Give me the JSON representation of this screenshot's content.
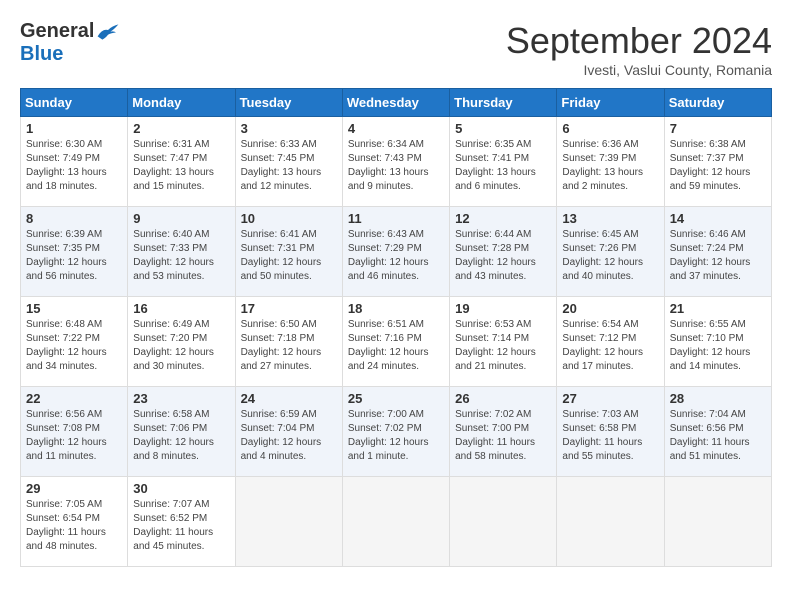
{
  "header": {
    "logo_general": "General",
    "logo_blue": "Blue",
    "title": "September 2024",
    "location": "Ivesti, Vaslui County, Romania"
  },
  "weekdays": [
    "Sunday",
    "Monday",
    "Tuesday",
    "Wednesday",
    "Thursday",
    "Friday",
    "Saturday"
  ],
  "weeks": [
    [
      {
        "day": "1",
        "sunrise": "6:30 AM",
        "sunset": "7:49 PM",
        "daylight": "13 hours and 18 minutes."
      },
      {
        "day": "2",
        "sunrise": "6:31 AM",
        "sunset": "7:47 PM",
        "daylight": "13 hours and 15 minutes."
      },
      {
        "day": "3",
        "sunrise": "6:33 AM",
        "sunset": "7:45 PM",
        "daylight": "13 hours and 12 minutes."
      },
      {
        "day": "4",
        "sunrise": "6:34 AM",
        "sunset": "7:43 PM",
        "daylight": "13 hours and 9 minutes."
      },
      {
        "day": "5",
        "sunrise": "6:35 AM",
        "sunset": "7:41 PM",
        "daylight": "13 hours and 6 minutes."
      },
      {
        "day": "6",
        "sunrise": "6:36 AM",
        "sunset": "7:39 PM",
        "daylight": "13 hours and 2 minutes."
      },
      {
        "day": "7",
        "sunrise": "6:38 AM",
        "sunset": "7:37 PM",
        "daylight": "12 hours and 59 minutes."
      }
    ],
    [
      {
        "day": "8",
        "sunrise": "6:39 AM",
        "sunset": "7:35 PM",
        "daylight": "12 hours and 56 minutes."
      },
      {
        "day": "9",
        "sunrise": "6:40 AM",
        "sunset": "7:33 PM",
        "daylight": "12 hours and 53 minutes."
      },
      {
        "day": "10",
        "sunrise": "6:41 AM",
        "sunset": "7:31 PM",
        "daylight": "12 hours and 50 minutes."
      },
      {
        "day": "11",
        "sunrise": "6:43 AM",
        "sunset": "7:29 PM",
        "daylight": "12 hours and 46 minutes."
      },
      {
        "day": "12",
        "sunrise": "6:44 AM",
        "sunset": "7:28 PM",
        "daylight": "12 hours and 43 minutes."
      },
      {
        "day": "13",
        "sunrise": "6:45 AM",
        "sunset": "7:26 PM",
        "daylight": "12 hours and 40 minutes."
      },
      {
        "day": "14",
        "sunrise": "6:46 AM",
        "sunset": "7:24 PM",
        "daylight": "12 hours and 37 minutes."
      }
    ],
    [
      {
        "day": "15",
        "sunrise": "6:48 AM",
        "sunset": "7:22 PM",
        "daylight": "12 hours and 34 minutes."
      },
      {
        "day": "16",
        "sunrise": "6:49 AM",
        "sunset": "7:20 PM",
        "daylight": "12 hours and 30 minutes."
      },
      {
        "day": "17",
        "sunrise": "6:50 AM",
        "sunset": "7:18 PM",
        "daylight": "12 hours and 27 minutes."
      },
      {
        "day": "18",
        "sunrise": "6:51 AM",
        "sunset": "7:16 PM",
        "daylight": "12 hours and 24 minutes."
      },
      {
        "day": "19",
        "sunrise": "6:53 AM",
        "sunset": "7:14 PM",
        "daylight": "12 hours and 21 minutes."
      },
      {
        "day": "20",
        "sunrise": "6:54 AM",
        "sunset": "7:12 PM",
        "daylight": "12 hours and 17 minutes."
      },
      {
        "day": "21",
        "sunrise": "6:55 AM",
        "sunset": "7:10 PM",
        "daylight": "12 hours and 14 minutes."
      }
    ],
    [
      {
        "day": "22",
        "sunrise": "6:56 AM",
        "sunset": "7:08 PM",
        "daylight": "12 hours and 11 minutes."
      },
      {
        "day": "23",
        "sunrise": "6:58 AM",
        "sunset": "7:06 PM",
        "daylight": "12 hours and 8 minutes."
      },
      {
        "day": "24",
        "sunrise": "6:59 AM",
        "sunset": "7:04 PM",
        "daylight": "12 hours and 4 minutes."
      },
      {
        "day": "25",
        "sunrise": "7:00 AM",
        "sunset": "7:02 PM",
        "daylight": "12 hours and 1 minute."
      },
      {
        "day": "26",
        "sunrise": "7:02 AM",
        "sunset": "7:00 PM",
        "daylight": "11 hours and 58 minutes."
      },
      {
        "day": "27",
        "sunrise": "7:03 AM",
        "sunset": "6:58 PM",
        "daylight": "11 hours and 55 minutes."
      },
      {
        "day": "28",
        "sunrise": "7:04 AM",
        "sunset": "6:56 PM",
        "daylight": "11 hours and 51 minutes."
      }
    ],
    [
      {
        "day": "29",
        "sunrise": "7:05 AM",
        "sunset": "6:54 PM",
        "daylight": "11 hours and 48 minutes."
      },
      {
        "day": "30",
        "sunrise": "7:07 AM",
        "sunset": "6:52 PM",
        "daylight": "11 hours and 45 minutes."
      },
      null,
      null,
      null,
      null,
      null
    ]
  ]
}
